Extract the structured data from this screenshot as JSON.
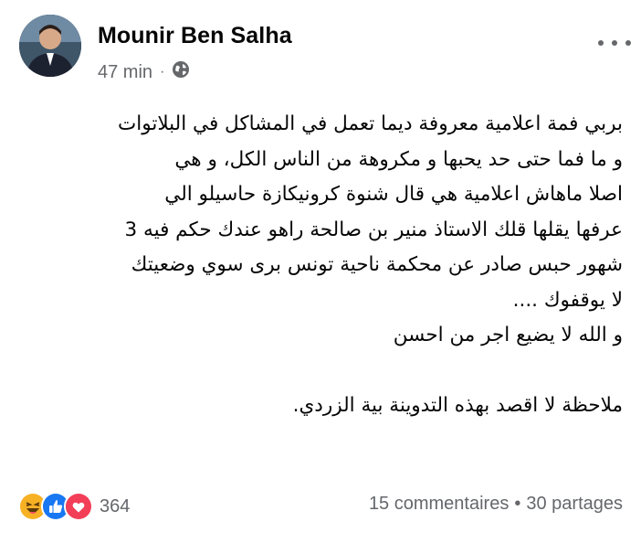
{
  "post": {
    "author": "Mounir Ben Salha",
    "time": "47 min",
    "audience_icon": "globe-icon",
    "body_lines": [
      "بربي فمة اعلامية معروفة ديما تعمل في المشاكل في البلاتوات",
      "و ما فما حتى حد يحبها و مكروهة من الناس الكل،  و هي",
      "اصلا ماهاش  اعلامية هي قال شنوة كرونيكازة حاسيلو الي",
      "عرفها يقلها قلك الاستاذ منير بن صالحة راهو عندك حكم فيه 3",
      "شهور حبس صادر عن محكمة ناحية تونس برى سوي وضعيتك",
      "لا يوقفوك ....",
      "و الله لا يضيع اجر من احسن",
      "ملاحظة لا اقصد بهذه التدوينة بية الزردي."
    ]
  },
  "footer": {
    "reaction_icons": [
      "haha-icon",
      "like-icon",
      "love-icon"
    ],
    "reaction_count": "364",
    "comments": "15 commentaires",
    "separator": "•",
    "shares": "30 partages"
  },
  "colors": {
    "text": "#050505",
    "secondary": "#65676b",
    "like_blue": "#1877f2",
    "love_red": "#f33e58",
    "haha_yellow": "#f7b125"
  }
}
